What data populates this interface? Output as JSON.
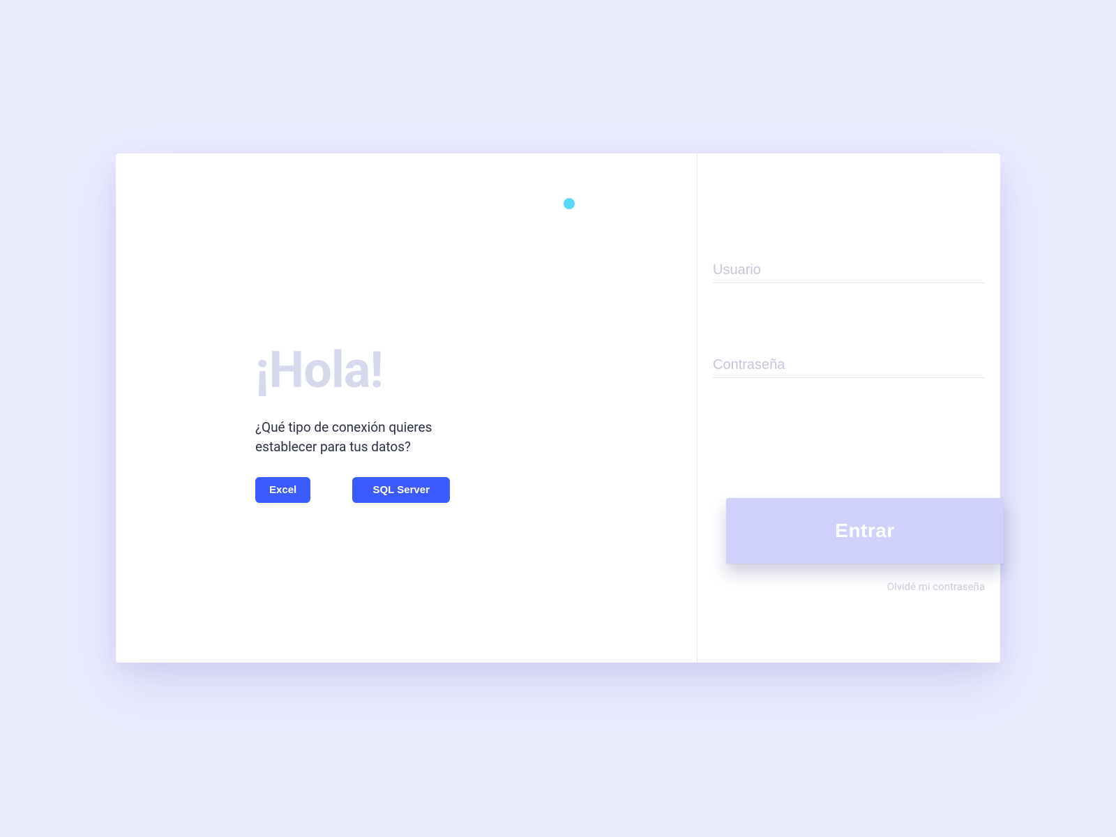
{
  "hero": {
    "title": "¡Hola!",
    "subtitle": "¿Qué tipo de conexión quieres establecer para tus datos?",
    "buttons": {
      "excel": "Excel",
      "sql": "SQL Server"
    }
  },
  "login": {
    "user_placeholder": "Usuario",
    "password_placeholder": "Contraseña",
    "submit_label": "Entrar",
    "forgot_label": "Olvidé mi contraseña"
  },
  "colors": {
    "background": "#ECECFF",
    "card": "#FFFFFF",
    "accent_dot": "#5CD6F5",
    "title_muted": "#D6D9EC",
    "text_dark": "#2B3044",
    "primary_button": "#3B5BFF",
    "enter_button": "#CFD1FB",
    "placeholder": "#C4C7D9",
    "forgot_text": "#C9CCDD"
  }
}
